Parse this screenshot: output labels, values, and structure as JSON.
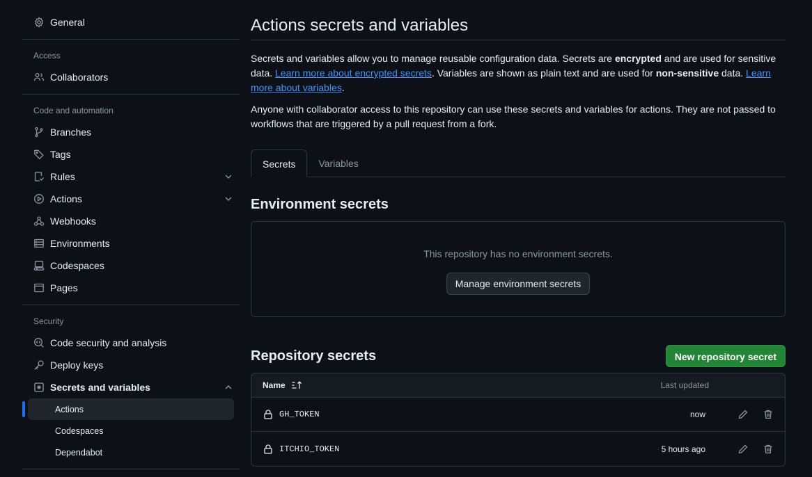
{
  "sidebar": {
    "general": "General",
    "access_title": "Access",
    "collaborators": "Collaborators",
    "code_title": "Code and automation",
    "branches": "Branches",
    "tags": "Tags",
    "rules": "Rules",
    "actions": "Actions",
    "webhooks": "Webhooks",
    "environments": "Environments",
    "codespaces": "Codespaces",
    "pages": "Pages",
    "security_title": "Security",
    "code_security": "Code security and analysis",
    "deploy_keys": "Deploy keys",
    "secrets_vars": "Secrets and variables",
    "sub_actions": "Actions",
    "sub_codespaces": "Codespaces",
    "sub_dependabot": "Dependabot"
  },
  "main": {
    "title": "Actions secrets and variables",
    "desc1_a": "Secrets and variables allow you to manage reusable configuration data. Secrets are ",
    "desc1_b": "encrypted",
    "desc1_c": " and are used for sensitive data. ",
    "desc1_link1": "Learn more about encrypted secrets",
    "desc1_d": ". Variables are shown as plain text and are used for ",
    "desc1_e": "non-sensitive",
    "desc1_f": " data. ",
    "desc1_link2": "Learn more about variables",
    "desc1_g": ".",
    "desc2": "Anyone with collaborator access to this repository can use these secrets and variables for actions. They are not passed to workflows that are triggered by a pull request from a fork.",
    "tabs": [
      "Secrets",
      "Variables"
    ],
    "env_title": "Environment secrets",
    "env_empty": "This repository has no environment secrets.",
    "env_button": "Manage environment secrets",
    "repo_title": "Repository secrets",
    "new_button": "New repository secret",
    "col_name": "Name",
    "col_updated": "Last updated",
    "secrets": [
      {
        "name": "GH_TOKEN",
        "updated": "now"
      },
      {
        "name": "ITCHIO_TOKEN",
        "updated": "5 hours ago"
      }
    ]
  },
  "colors": {
    "background": "#0d1117",
    "accent": "#1f6feb",
    "link": "#4493f8",
    "green": "#238636"
  }
}
